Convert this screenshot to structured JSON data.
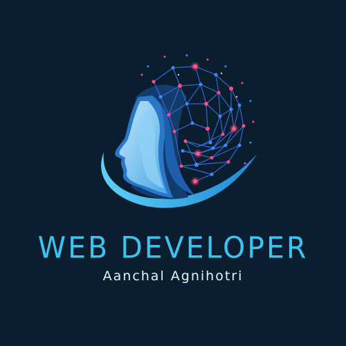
{
  "logo": {
    "title": "WEB DEVELOPER",
    "name": "Aanchal Agnihotri",
    "icon": "ai-head-network-icon"
  },
  "colors": {
    "background": "#0b1e2f",
    "title": "#3cc4f0",
    "name": "#e9f1f7",
    "network_lines": "#3a6fe0",
    "node_pink": "#ff2d6f",
    "node_blue": "#3d8bff"
  }
}
